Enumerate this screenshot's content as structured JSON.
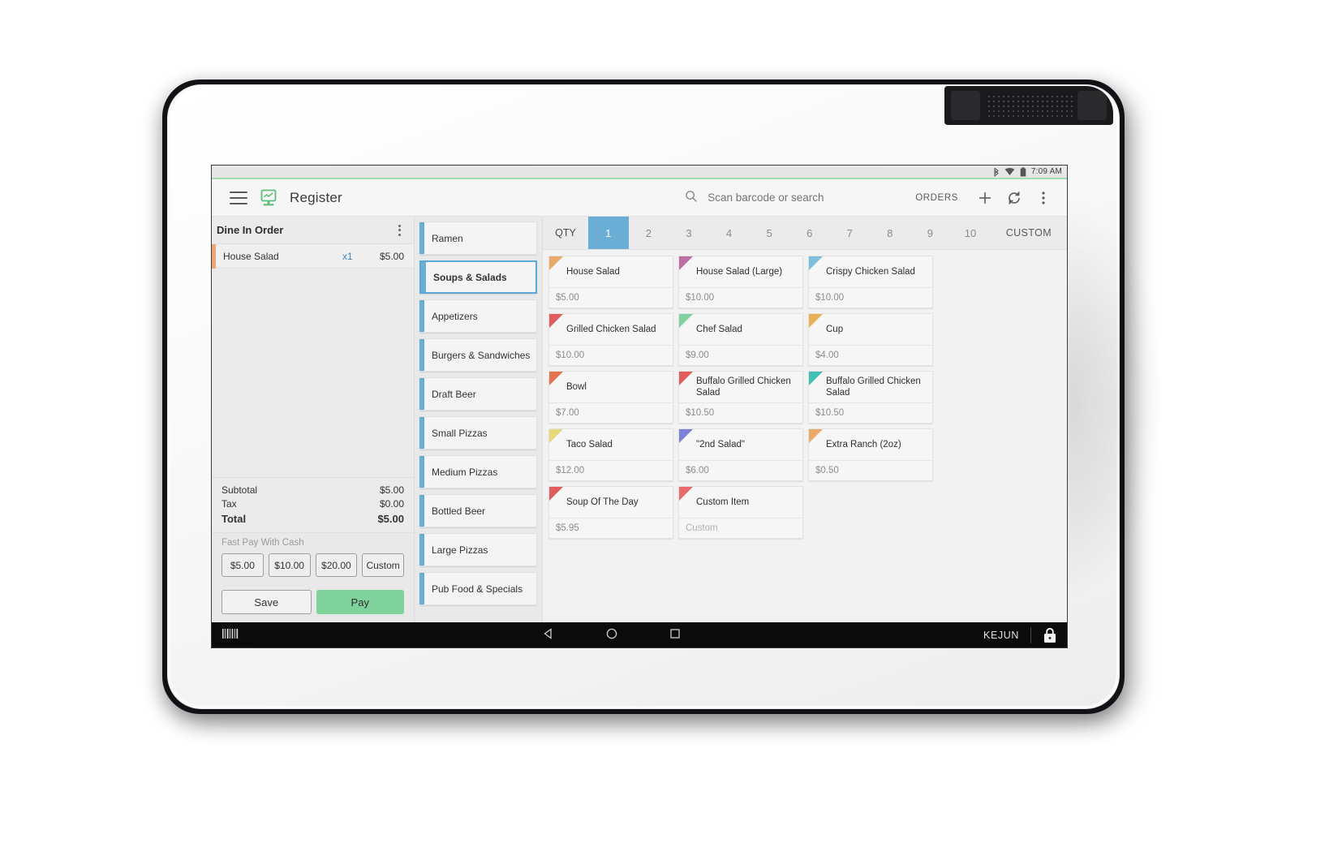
{
  "statusbar": {
    "bluetooth_icon": "bluetooth-icon",
    "wifi_icon": "wifi-icon",
    "battery_icon": "battery-icon",
    "time": "7:09 AM"
  },
  "appbar": {
    "menu_icon": "hamburger-menu-icon",
    "logo_icon": "register-logo-icon",
    "title": "Register",
    "search_icon": "search-icon",
    "search_placeholder": "Scan barcode or search",
    "search_value": "",
    "orders_label": "ORDERS",
    "add_icon": "plus-icon",
    "refresh_icon": "refresh-icon",
    "overflow_icon": "more-vertical-icon"
  },
  "order": {
    "title": "Dine In Order",
    "overflow_icon": "more-vertical-icon",
    "items": [
      {
        "name": "House Salad",
        "qty": "x1",
        "price": "$5.00",
        "accent": "#e8a878"
      }
    ],
    "totals": [
      {
        "label": "Subtotal",
        "value": "$5.00",
        "bold": false
      },
      {
        "label": "Tax",
        "value": "$0.00",
        "bold": false
      },
      {
        "label": "Total",
        "value": "$5.00",
        "bold": true
      }
    ],
    "fast_pay_label": "Fast Pay With Cash",
    "fast_pay_chips": [
      "$5.00",
      "$10.00",
      "$20.00",
      "Custom"
    ],
    "save_label": "Save",
    "pay_label": "Pay"
  },
  "categories": [
    {
      "label": "Ramen",
      "active": false
    },
    {
      "label": "Soups & Salads",
      "active": true
    },
    {
      "label": "Appetizers",
      "active": false
    },
    {
      "label": "Burgers & Sandwiches",
      "active": false
    },
    {
      "label": "Draft Beer",
      "active": false
    },
    {
      "label": "Small Pizzas",
      "active": false
    },
    {
      "label": "Medium Pizzas",
      "active": false
    },
    {
      "label": "Bottled Beer",
      "active": false
    },
    {
      "label": "Large Pizzas",
      "active": false
    },
    {
      "label": "Pub Food & Specials",
      "active": false
    }
  ],
  "qty_bar": {
    "label": "QTY",
    "options": [
      "1",
      "2",
      "3",
      "4",
      "5",
      "6",
      "7",
      "8",
      "9",
      "10"
    ],
    "selected": "1",
    "custom_label": "CUSTOM"
  },
  "products": [
    {
      "name": "House Salad",
      "price": "$5.00",
      "color": "#eaa869"
    },
    {
      "name": "House Salad (Large)",
      "price": "$10.00",
      "color": "#bd6fa4"
    },
    {
      "name": "Crispy Chicken Salad",
      "price": "$10.00",
      "color": "#7cc0dd"
    },
    {
      "name": "Grilled Chicken Salad",
      "price": "$10.00",
      "color": "#e15c5c"
    },
    {
      "name": "Chef Salad",
      "price": "$9.00",
      "color": "#7ed2a0"
    },
    {
      "name": "Cup",
      "price": "$4.00",
      "color": "#e8b155"
    },
    {
      "name": "Bowl",
      "price": "$7.00",
      "color": "#e2744f"
    },
    {
      "name": "Buffalo Grilled Chicken Salad",
      "price": "$10.50",
      "color": "#e15c5c"
    },
    {
      "name": "Buffalo Grilled Chicken Salad",
      "price": "$10.50",
      "color": "#3fc0b0"
    },
    {
      "name": "Taco Salad",
      "price": "$12.00",
      "color": "#e6da7c"
    },
    {
      "name": "\"2nd Salad\"",
      "price": "$6.00",
      "color": "#7b82d8"
    },
    {
      "name": "Extra Ranch (2oz)",
      "price": "$0.50",
      "color": "#eaa869"
    },
    {
      "name": "Soup Of The Day",
      "price": "$5.95",
      "color": "#e15c5c"
    },
    {
      "name": "Custom Item",
      "price": "Custom",
      "color": "#e86a6a",
      "price_placeholder": true
    }
  ],
  "navbar": {
    "barcode_icon": "barcode-icon",
    "back_icon": "back-triangle-icon",
    "home_icon": "home-circle-icon",
    "recent_icon": "recent-square-icon",
    "user": "KEJUN",
    "lock_icon": "lock-icon"
  },
  "colors": {
    "accent_blue": "#6aaed6",
    "pay_green": "#7ed29a",
    "status_green": "#a5dcb0",
    "order_accent": "#e8a878"
  }
}
